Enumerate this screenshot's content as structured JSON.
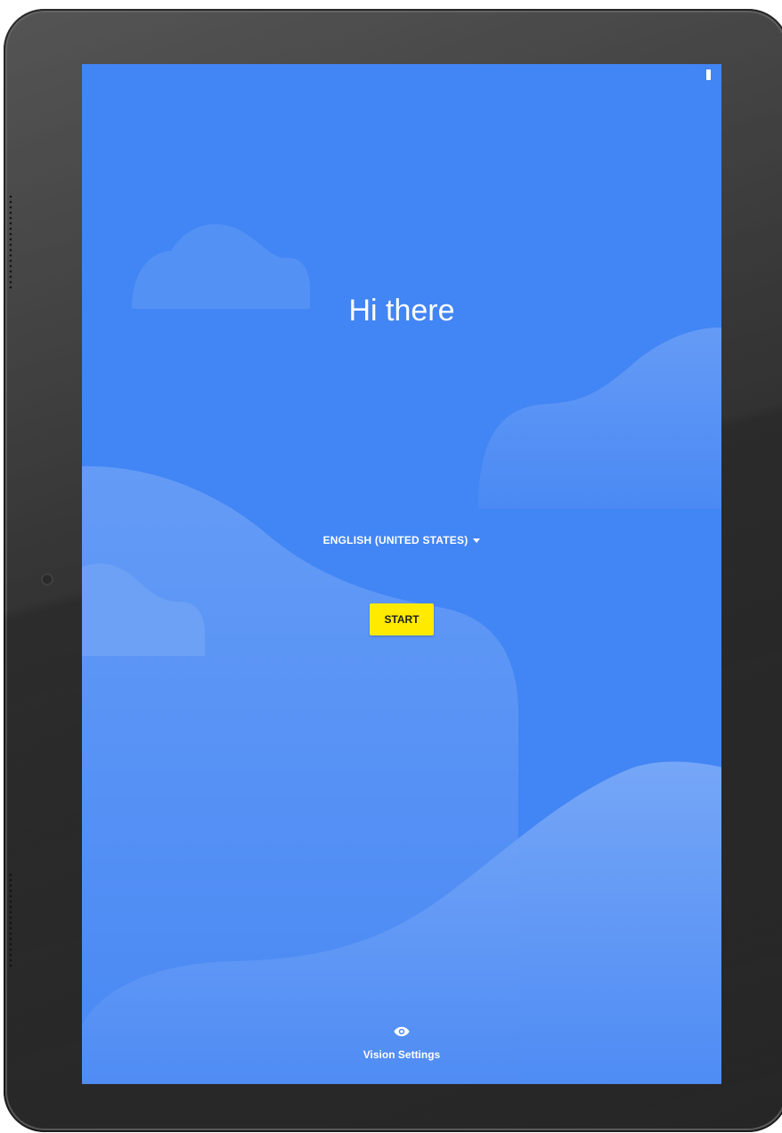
{
  "welcome": {
    "title": "Hi there",
    "language_selector": "ENGLISH (UNITED STATES)",
    "start_button": "START",
    "vision_settings": "Vision Settings"
  },
  "icons": {
    "language_caret": "chevron-down-icon",
    "vision": "eye-icon",
    "status": "battery-icon"
  },
  "colors": {
    "background": "#4285f4",
    "start_button": "#ffea00",
    "text": "#ffffff"
  }
}
